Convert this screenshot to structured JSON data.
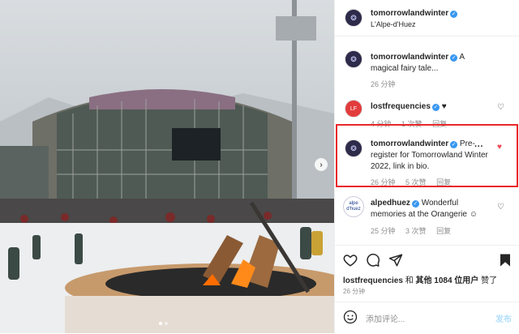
{
  "post": {
    "author": "tomorrowlandwinter",
    "location": "L'Alpe-d'Huez",
    "caption_comment": {
      "user": "tomorrowlandwinter",
      "text": "A magical fairy tale...",
      "time": "26 分钟"
    }
  },
  "comments": [
    {
      "user": "lostfrequencies",
      "text": "♥",
      "time": "4 分钟",
      "likes": "1 次赞",
      "reply": "回复"
    },
    {
      "user": "tomorrowlandwinter",
      "text": "Pre-register for Tomorrowland Winter 2022, link in bio.",
      "time": "26 分钟",
      "likes": "5 次赞",
      "reply": "回复"
    },
    {
      "user": "alpedhuez",
      "text": "Wonderful memories at the Orangerie ☺",
      "time": "25 分钟",
      "likes": "3 次赞",
      "reply": "回复"
    }
  ],
  "likes_line": {
    "user": "lostfrequencies",
    "joiner": "和",
    "others": "其他 1084 位用户",
    "suffix": "赞了"
  },
  "post_time": "26 分钟",
  "comment_box": {
    "placeholder": "添加评论...",
    "post_label": "发布"
  },
  "avatars": {
    "tml": "❂",
    "lost": "LF",
    "alpe": "alpe d'huez"
  },
  "colors": {
    "highlight": "#e8272a",
    "verified": "#3897f0",
    "liked_heart": "#ed4956"
  }
}
